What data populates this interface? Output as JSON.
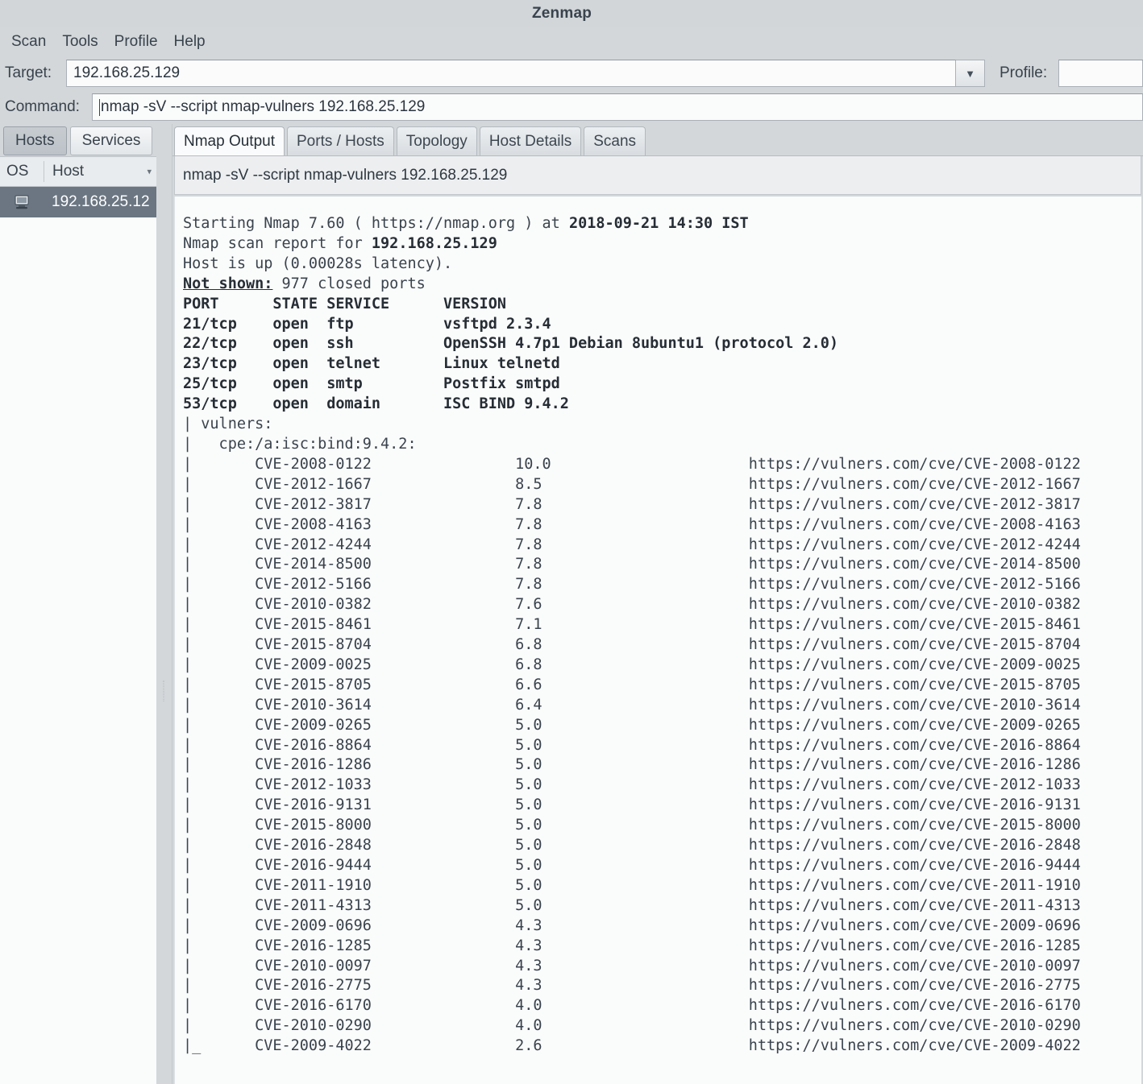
{
  "window": {
    "title": "Zenmap"
  },
  "menubar": {
    "items": [
      {
        "label": "Scan"
      },
      {
        "label": "Tools"
      },
      {
        "label": "Profile"
      },
      {
        "label": "Help"
      }
    ]
  },
  "toolbar": {
    "target_label": "Target:",
    "target_value": "192.168.25.129",
    "target_placeholder": "",
    "target_dropdown_icon": "chevron-down-icon",
    "profile_label": "Profile:",
    "profile_value": "",
    "profile_placeholder": "",
    "command_label": "Command:",
    "command_value": "nmap -sV --script nmap-vulners 192.168.25.129",
    "command_placeholder": ""
  },
  "sidebar": {
    "tabs": [
      {
        "label": "Hosts",
        "active": true
      },
      {
        "label": "Services",
        "active": false
      }
    ],
    "columns": {
      "os": "OS",
      "host": "Host",
      "sort_caret": "▾"
    },
    "hosts": [
      {
        "name": "192.168.25.12",
        "icon": "host-computer-icon",
        "selected": true
      }
    ]
  },
  "main": {
    "tabs": [
      {
        "label": "Nmap Output",
        "active": true
      },
      {
        "label": "Ports / Hosts",
        "active": false
      },
      {
        "label": "Topology",
        "active": false
      },
      {
        "label": "Host Details",
        "active": false
      },
      {
        "label": "Scans",
        "active": false
      }
    ],
    "command_bar": "nmap -sV --script nmap-vulners 192.168.25.129"
  },
  "output": {
    "header_lines": [
      {
        "pre": "Starting Nmap 7.60 ( https://nmap.org ) at ",
        "bold": "2018-09-21 14:30 IST",
        "post": ""
      },
      {
        "pre": "Nmap scan report for ",
        "bold": "192.168.25.129",
        "post": ""
      },
      {
        "pre": "Host is up (0.00028s latency).",
        "bold": "",
        "post": ""
      }
    ],
    "not_shown_label": "Not shown:",
    "not_shown_value": " 977 closed ports",
    "port_table_header": "PORT      STATE SERVICE      VERSION",
    "ports": [
      {
        "port": "21/tcp",
        "state": "open",
        "service": "ftp",
        "version": "vsftpd 2.3.4"
      },
      {
        "port": "22/tcp",
        "state": "open",
        "service": "ssh",
        "version": "OpenSSH 4.7p1 Debian 8ubuntu1 (protocol 2.0)"
      },
      {
        "port": "23/tcp",
        "state": "open",
        "service": "telnet",
        "version": "Linux telnetd"
      },
      {
        "port": "25/tcp",
        "state": "open",
        "service": "smtp",
        "version": "Postfix smtpd"
      },
      {
        "port": "53/tcp",
        "state": "open",
        "service": "domain",
        "version": "ISC BIND 9.4.2"
      }
    ],
    "vulners_label": "| vulners:",
    "cpe_label": "|   cpe:/a:isc:bind:9.4.2:",
    "cve_entries": [
      {
        "id": "CVE-2008-0122",
        "score": "10.0",
        "url": "https://vulners.com/cve/CVE-2008-0122"
      },
      {
        "id": "CVE-2012-1667",
        "score": "8.5",
        "url": "https://vulners.com/cve/CVE-2012-1667"
      },
      {
        "id": "CVE-2012-3817",
        "score": "7.8",
        "url": "https://vulners.com/cve/CVE-2012-3817"
      },
      {
        "id": "CVE-2008-4163",
        "score": "7.8",
        "url": "https://vulners.com/cve/CVE-2008-4163"
      },
      {
        "id": "CVE-2012-4244",
        "score": "7.8",
        "url": "https://vulners.com/cve/CVE-2012-4244"
      },
      {
        "id": "CVE-2014-8500",
        "score": "7.8",
        "url": "https://vulners.com/cve/CVE-2014-8500"
      },
      {
        "id": "CVE-2012-5166",
        "score": "7.8",
        "url": "https://vulners.com/cve/CVE-2012-5166"
      },
      {
        "id": "CVE-2010-0382",
        "score": "7.6",
        "url": "https://vulners.com/cve/CVE-2010-0382"
      },
      {
        "id": "CVE-2015-8461",
        "score": "7.1",
        "url": "https://vulners.com/cve/CVE-2015-8461"
      },
      {
        "id": "CVE-2015-8704",
        "score": "6.8",
        "url": "https://vulners.com/cve/CVE-2015-8704"
      },
      {
        "id": "CVE-2009-0025",
        "score": "6.8",
        "url": "https://vulners.com/cve/CVE-2009-0025"
      },
      {
        "id": "CVE-2015-8705",
        "score": "6.6",
        "url": "https://vulners.com/cve/CVE-2015-8705"
      },
      {
        "id": "CVE-2010-3614",
        "score": "6.4",
        "url": "https://vulners.com/cve/CVE-2010-3614"
      },
      {
        "id": "CVE-2009-0265",
        "score": "5.0",
        "url": "https://vulners.com/cve/CVE-2009-0265"
      },
      {
        "id": "CVE-2016-8864",
        "score": "5.0",
        "url": "https://vulners.com/cve/CVE-2016-8864"
      },
      {
        "id": "CVE-2016-1286",
        "score": "5.0",
        "url": "https://vulners.com/cve/CVE-2016-1286"
      },
      {
        "id": "CVE-2012-1033",
        "score": "5.0",
        "url": "https://vulners.com/cve/CVE-2012-1033"
      },
      {
        "id": "CVE-2016-9131",
        "score": "5.0",
        "url": "https://vulners.com/cve/CVE-2016-9131"
      },
      {
        "id": "CVE-2015-8000",
        "score": "5.0",
        "url": "https://vulners.com/cve/CVE-2015-8000"
      },
      {
        "id": "CVE-2016-2848",
        "score": "5.0",
        "url": "https://vulners.com/cve/CVE-2016-2848"
      },
      {
        "id": "CVE-2016-9444",
        "score": "5.0",
        "url": "https://vulners.com/cve/CVE-2016-9444"
      },
      {
        "id": "CVE-2011-1910",
        "score": "5.0",
        "url": "https://vulners.com/cve/CVE-2011-1910"
      },
      {
        "id": "CVE-2011-4313",
        "score": "5.0",
        "url": "https://vulners.com/cve/CVE-2011-4313"
      },
      {
        "id": "CVE-2009-0696",
        "score": "4.3",
        "url": "https://vulners.com/cve/CVE-2009-0696"
      },
      {
        "id": "CVE-2016-1285",
        "score": "4.3",
        "url": "https://vulners.com/cve/CVE-2016-1285"
      },
      {
        "id": "CVE-2010-0097",
        "score": "4.3",
        "url": "https://vulners.com/cve/CVE-2010-0097"
      },
      {
        "id": "CVE-2016-2775",
        "score": "4.3",
        "url": "https://vulners.com/cve/CVE-2016-2775"
      },
      {
        "id": "CVE-2016-6170",
        "score": "4.0",
        "url": "https://vulners.com/cve/CVE-2016-6170"
      },
      {
        "id": "CVE-2010-0290",
        "score": "4.0",
        "url": "https://vulners.com/cve/CVE-2010-0290"
      },
      {
        "id": "CVE-2009-4022",
        "score": "2.6",
        "url": "https://vulners.com/cve/CVE-2009-4022"
      }
    ],
    "cve_prefix": "|     ",
    "cve_last_prefix": "|_    "
  },
  "colors": {
    "chrome": "#d3d7da",
    "selection": "#6b7682",
    "text": "#39434d",
    "field_bg": "#fbfbfc",
    "output_bg": "#fafbfb"
  }
}
